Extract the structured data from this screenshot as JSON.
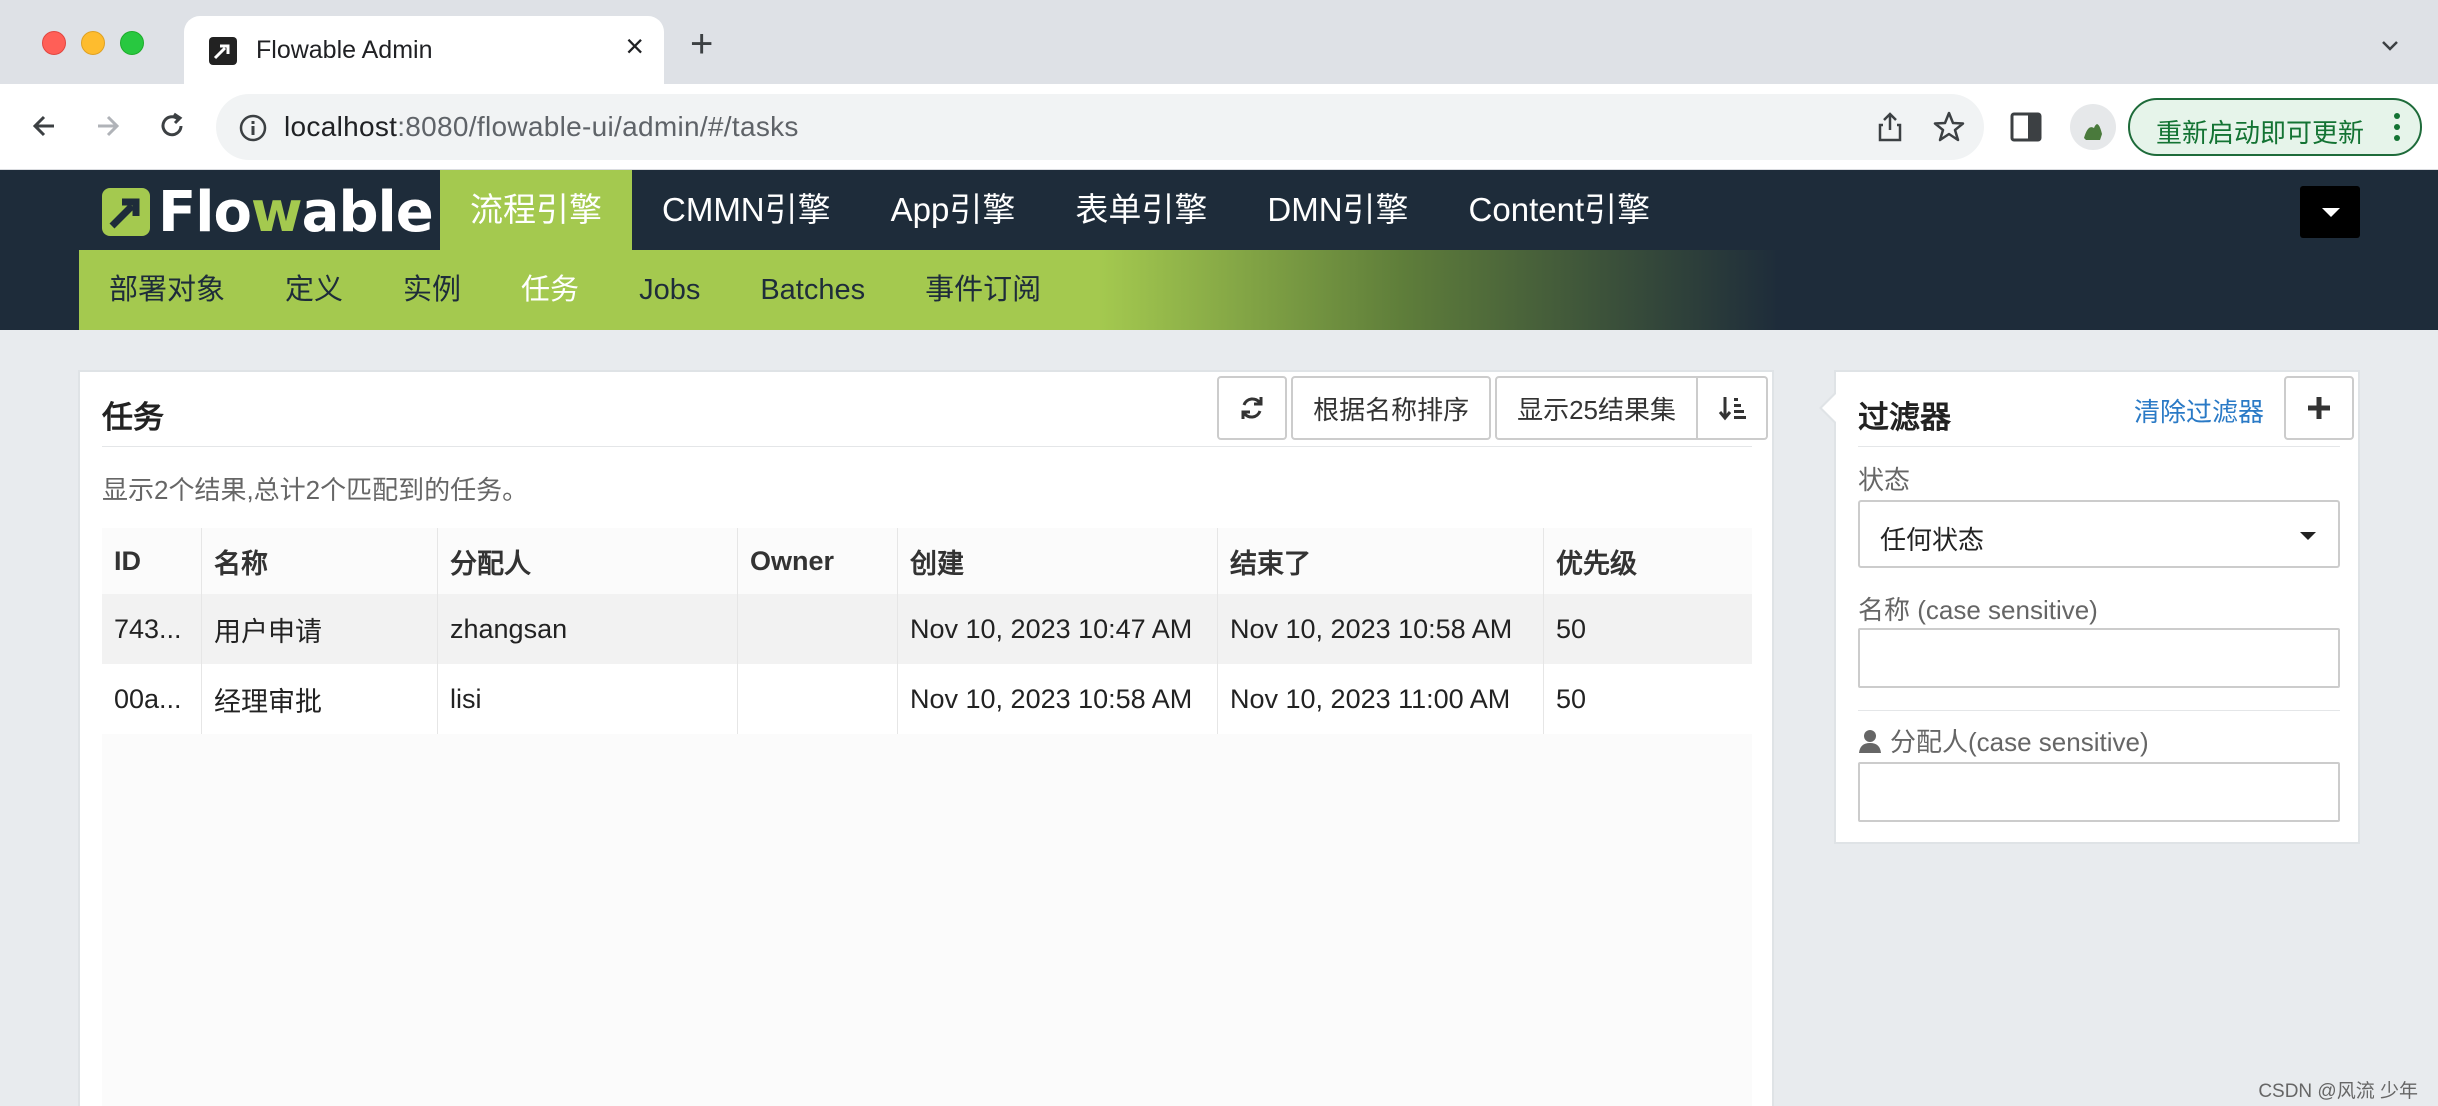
{
  "browser": {
    "tab_title": "Flowable Admin",
    "url_host": "localhost",
    "url_rest": ":8080/flowable-ui/admin/#/tasks",
    "update_button": "重新启动即可更新"
  },
  "app": {
    "logo_prefix": "Flo",
    "logo_suffix": "able",
    "logo_w": "w",
    "main_nav": [
      "流程引擎",
      "CMMN引擎",
      "App引擎",
      "表单引擎",
      "DMN引擎",
      "Content引擎"
    ],
    "sub_nav": [
      "部署对象",
      "定义",
      "实例",
      "任务",
      "Jobs",
      "Batches",
      "事件订阅"
    ]
  },
  "tasks": {
    "title": "任务",
    "sort_button": "根据名称排序",
    "page_size_button": "显示25结果集",
    "summary": "显示2个结果,总计2个匹配到的任务。",
    "columns": [
      "ID",
      "名称",
      "分配人",
      "Owner",
      "创建",
      "结束了",
      "优先级"
    ],
    "rows": [
      [
        "743...",
        "用户申请",
        "zhangsan",
        "",
        "Nov 10, 2023 10:47 AM",
        "Nov 10, 2023 10:58 AM",
        "50"
      ],
      [
        "00a...",
        "经理审批",
        "lisi",
        "",
        "Nov 10, 2023 10:58 AM",
        "Nov 10, 2023 11:00 AM",
        "50"
      ]
    ]
  },
  "filter": {
    "title": "过滤器",
    "clear_link": "清除过滤器",
    "status_label": "状态",
    "status_value": "任何状态",
    "name_label": "名称 (case sensitive)",
    "name_value": "",
    "assignee_label": "分配人(case sensitive)",
    "assignee_value": ""
  },
  "watermark": "CSDN @风流 少年",
  "colors": {
    "accent": "#a4c94f",
    "header_bg": "#1e2c3a",
    "link": "#2a7ac6"
  }
}
